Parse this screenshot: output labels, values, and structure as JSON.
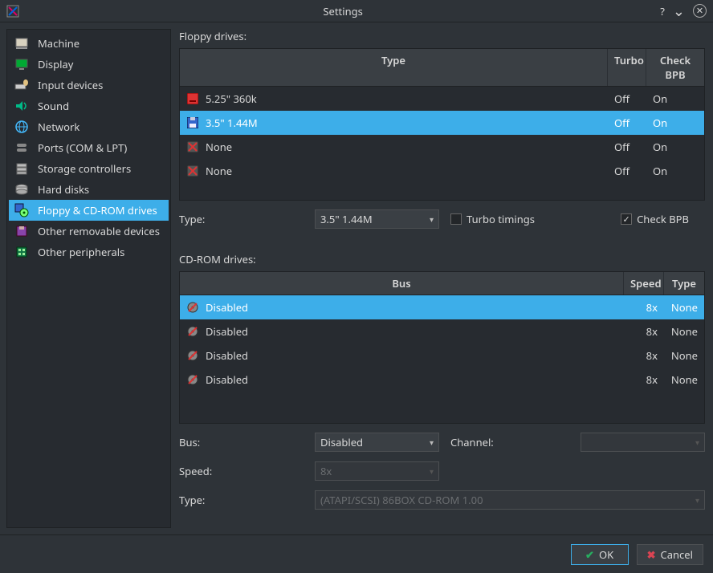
{
  "window": {
    "title": "Settings"
  },
  "sidebar": {
    "items": [
      {
        "label": "Machine"
      },
      {
        "label": "Display"
      },
      {
        "label": "Input devices"
      },
      {
        "label": "Sound"
      },
      {
        "label": "Network"
      },
      {
        "label": "Ports (COM & LPT)"
      },
      {
        "label": "Storage controllers"
      },
      {
        "label": "Hard disks"
      },
      {
        "label": "Floppy & CD-ROM drives"
      },
      {
        "label": "Other removable devices"
      },
      {
        "label": "Other peripherals"
      }
    ],
    "selectedIndex": 8
  },
  "floppy": {
    "sectionLabel": "Floppy drives:",
    "headers": {
      "type": "Type",
      "turbo": "Turbo",
      "checkBPB": "Check BPB"
    },
    "rows": [
      {
        "type": "5.25\" 360k",
        "turbo": "Off",
        "check": "On"
      },
      {
        "type": "3.5\" 1.44M",
        "turbo": "Off",
        "check": "On"
      },
      {
        "type": "None",
        "turbo": "Off",
        "check": "On"
      },
      {
        "type": "None",
        "turbo": "Off",
        "check": "On"
      }
    ],
    "selectedIndex": 1,
    "form": {
      "typeLabel": "Type:",
      "typeValue": "3.5\" 1.44M",
      "turboLabel": "Turbo timings",
      "turboChecked": false,
      "checkBPBLabel": "Check BPB",
      "checkBPBChecked": true
    }
  },
  "cdrom": {
    "sectionLabel": "CD-ROM drives:",
    "headers": {
      "bus": "Bus",
      "speed": "Speed",
      "type": "Type"
    },
    "rows": [
      {
        "bus": "Disabled",
        "speed": "8x",
        "ctype": "None"
      },
      {
        "bus": "Disabled",
        "speed": "8x",
        "ctype": "None"
      },
      {
        "bus": "Disabled",
        "speed": "8x",
        "ctype": "None"
      },
      {
        "bus": "Disabled",
        "speed": "8x",
        "ctype": "None"
      }
    ],
    "selectedIndex": 0,
    "form": {
      "busLabel": "Bus:",
      "busValue": "Disabled",
      "channelLabel": "Channel:",
      "channelValue": "",
      "speedLabel": "Speed:",
      "speedValue": "8x",
      "typeLabel": "Type:",
      "typeValue": "(ATAPI/SCSI) 86BOX CD-ROM 1.00"
    }
  },
  "buttons": {
    "ok": "OK",
    "cancel": "Cancel"
  },
  "titlebar": {
    "help": "?",
    "down": "⌄",
    "close": "✕"
  }
}
